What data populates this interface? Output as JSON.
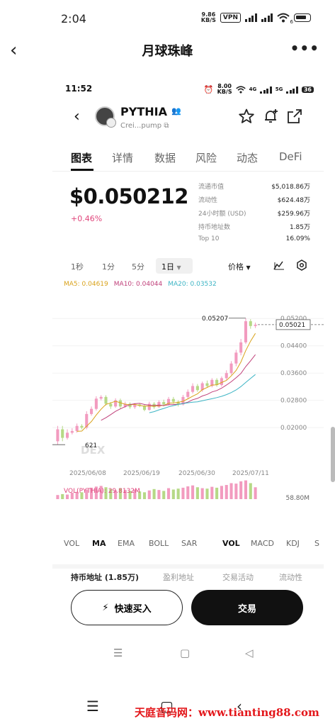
{
  "outer_status": {
    "time": "2:04",
    "speed_value": "9.86",
    "speed_unit": "KB/S",
    "vpn": "VPN",
    "wifi_sub": "6"
  },
  "outer_nav": {
    "back": "‹",
    "title": "月球珠峰",
    "more": "•••"
  },
  "inner_status": {
    "time": "11:52",
    "speed_value": "8.00",
    "speed_unit": "KB/S",
    "badge": "36",
    "net1": "4G",
    "net2": "5G"
  },
  "token": {
    "name": "PYTHIA",
    "address": "Crei...pump"
  },
  "tabs": [
    "图表",
    "详情",
    "数据",
    "风险",
    "动态",
    "DeFi"
  ],
  "price": "$0.050212",
  "change": "+0.46%",
  "stats": [
    {
      "label": "流通市值",
      "value": "$5,018.86万"
    },
    {
      "label": "流动性",
      "value": "$624.48万"
    },
    {
      "label": "24小时额 (USD)",
      "value": "$259.96万"
    },
    {
      "label": "持币地址数",
      "value": "1.85万"
    },
    {
      "label": "Top 10",
      "value": "16.09%"
    }
  ],
  "timeframes": [
    "1秒",
    "1分",
    "5分"
  ],
  "timeframe_active": "1日",
  "price_selector": "价格",
  "ma_legend": [
    {
      "label": "MA5: 0.04619",
      "color": "#d9a21a"
    },
    {
      "label": "MA10: 0.04044",
      "color": "#c0407a"
    },
    {
      "label": "MA20: 0.03532",
      "color": "#3cb4c4"
    }
  ],
  "chart_data": {
    "type": "candlestick",
    "y_ticks": [
      "0.05200",
      "0.04400",
      "0.03600",
      "0.02800",
      "0.02000"
    ],
    "x_ticks": [
      "2025/06/08",
      "2025/06/19",
      "2025/06/30",
      "2025/07/11"
    ],
    "ylim": [
      0.014,
      0.056
    ],
    "high_label": "0.05207",
    "low_label": "621",
    "last_price_label": "0.05021",
    "watermark": "DEX",
    "candles": [
      [
        0.016,
        0.0195,
        0.015,
        0.0205
      ],
      [
        0.0195,
        0.017,
        0.016,
        0.0205
      ],
      [
        0.017,
        0.0185,
        0.0165,
        0.0195
      ],
      [
        0.0185,
        0.019,
        0.018,
        0.0198
      ],
      [
        0.019,
        0.0205,
        0.0185,
        0.0212
      ],
      [
        0.0205,
        0.02,
        0.0195,
        0.021
      ],
      [
        0.02,
        0.024,
        0.0195,
        0.0248
      ],
      [
        0.024,
        0.0255,
        0.0235,
        0.0262
      ],
      [
        0.0255,
        0.0285,
        0.025,
        0.0292
      ],
      [
        0.0285,
        0.029,
        0.028,
        0.0295
      ],
      [
        0.029,
        0.027,
        0.0265,
        0.0295
      ],
      [
        0.027,
        0.0262,
        0.0255,
        0.0275
      ],
      [
        0.0262,
        0.028,
        0.0258,
        0.0286
      ],
      [
        0.028,
        0.0262,
        0.0255,
        0.0285
      ],
      [
        0.0262,
        0.027,
        0.0258,
        0.0276
      ],
      [
        0.027,
        0.026,
        0.0255,
        0.0274
      ],
      [
        0.026,
        0.0268,
        0.0255,
        0.0272
      ],
      [
        0.0268,
        0.0264,
        0.026,
        0.0272
      ],
      [
        0.0264,
        0.0252,
        0.0248,
        0.0268
      ],
      [
        0.0252,
        0.027,
        0.025,
        0.0276
      ],
      [
        0.027,
        0.026,
        0.0255,
        0.0275
      ],
      [
        0.026,
        0.0275,
        0.0258,
        0.028
      ],
      [
        0.0275,
        0.0268,
        0.0262,
        0.0282
      ],
      [
        0.0268,
        0.0284,
        0.0265,
        0.029
      ],
      [
        0.0284,
        0.0276,
        0.027,
        0.029
      ],
      [
        0.0276,
        0.0268,
        0.0262,
        0.028
      ],
      [
        0.0268,
        0.029,
        0.0265,
        0.0296
      ],
      [
        0.029,
        0.0305,
        0.0285,
        0.0312
      ],
      [
        0.0305,
        0.0322,
        0.03,
        0.033
      ],
      [
        0.0322,
        0.031,
        0.0305,
        0.0328
      ],
      [
        0.031,
        0.033,
        0.0305,
        0.0335
      ],
      [
        0.033,
        0.0322,
        0.0318,
        0.0338
      ],
      [
        0.0322,
        0.034,
        0.0318,
        0.0345
      ],
      [
        0.034,
        0.0325,
        0.032,
        0.0345
      ],
      [
        0.0325,
        0.0345,
        0.032,
        0.035
      ],
      [
        0.0345,
        0.036,
        0.034,
        0.0368
      ],
      [
        0.036,
        0.0388,
        0.0355,
        0.0395
      ],
      [
        0.0388,
        0.042,
        0.038,
        0.0428
      ],
      [
        0.042,
        0.045,
        0.0412,
        0.046
      ],
      [
        0.045,
        0.0512,
        0.0445,
        0.0521
      ],
      [
        0.0512,
        0.0498,
        0.049,
        0.0518
      ],
      [
        0.0498,
        0.0502,
        0.0492,
        0.0508
      ]
    ]
  },
  "vol_label": "VOL(PYTHIA): 29.8132M",
  "vol_axis": "58.80M",
  "volume": [
    0.18,
    0.22,
    0.2,
    0.28,
    0.32,
    0.3,
    0.42,
    0.5,
    0.55,
    0.58,
    0.52,
    0.44,
    0.38,
    0.48,
    0.4,
    0.36,
    0.42,
    0.34,
    0.3,
    0.38,
    0.44,
    0.4,
    0.36,
    0.48,
    0.42,
    0.46,
    0.5,
    0.56,
    0.6,
    0.52,
    0.48,
    0.46,
    0.54,
    0.5,
    0.58,
    0.62,
    0.7,
    0.68,
    0.78,
    0.82,
    0.7,
    0.52
  ],
  "indicators_left": [
    "VOL",
    "MA",
    "EMA",
    "BOLL",
    "SAR"
  ],
  "indicators_right": [
    "VOL",
    "MACD",
    "KDJ",
    "S"
  ],
  "peek_tabs": [
    "持币地址 (1.85万)",
    "盈利地址",
    "交易活动",
    "流动性"
  ],
  "buttons": {
    "quick_buy": "快速买入",
    "trade": "交易"
  },
  "inner_nav": {
    "menu": "☰",
    "home": "▢",
    "back": "◁"
  },
  "outer_bottom": {
    "menu": "☰",
    "home": "▢",
    "back": "‹"
  },
  "watermark_site": "天庭音码网：www.tianting88.com",
  "colors": {
    "up": "#f29bbf",
    "down": "#b6d986",
    "accent_pink": "#e0457b"
  }
}
